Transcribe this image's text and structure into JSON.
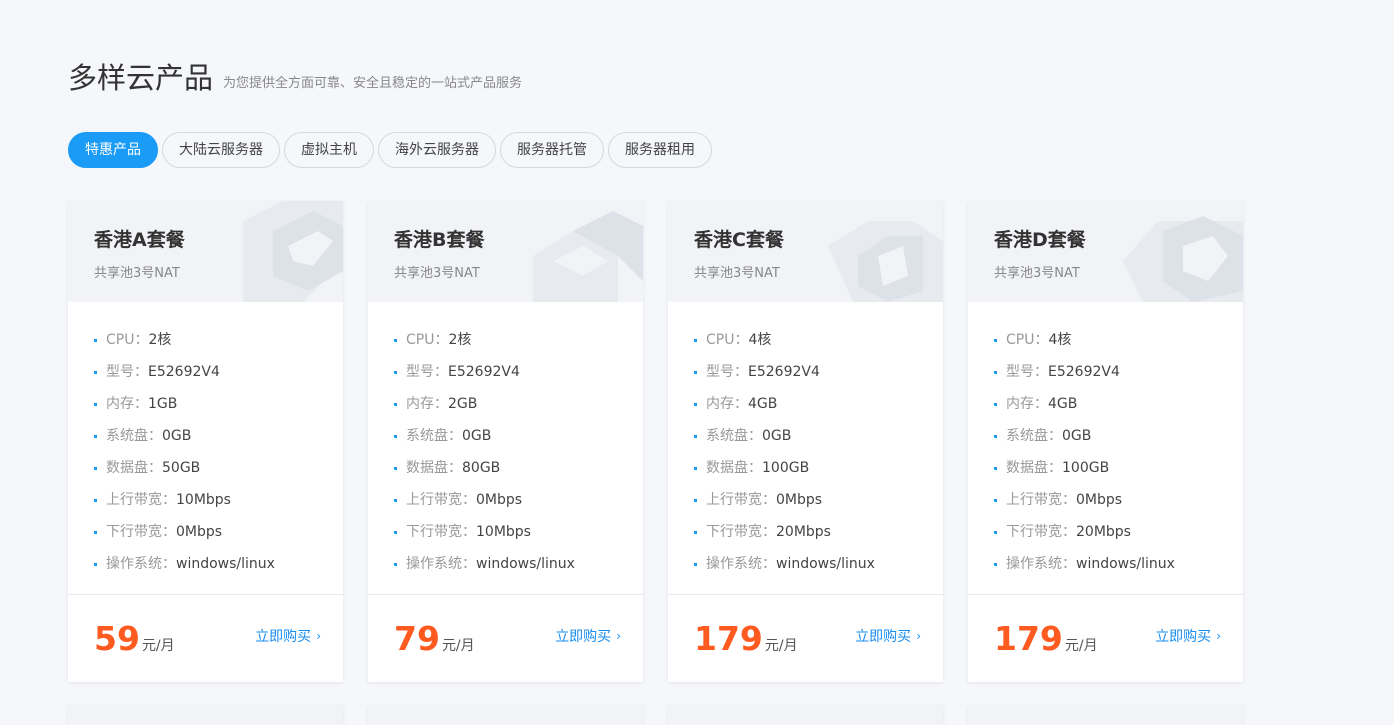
{
  "section": {
    "title": "多样云产品",
    "subtitle": "为您提供全方面可靠、安全且稳定的一站式产品服务"
  },
  "tabs": [
    {
      "label": "特惠产品",
      "active": true
    },
    {
      "label": "大陆云服务器",
      "active": false
    },
    {
      "label": "虚拟主机",
      "active": false
    },
    {
      "label": "海外云服务器",
      "active": false
    },
    {
      "label": "服务器托管",
      "active": false
    },
    {
      "label": "服务器租用",
      "active": false
    }
  ],
  "spec_labels": {
    "cpu": "CPU：",
    "model": "型号：",
    "memory": "内存：",
    "system_disk": "系统盘：",
    "data_disk": "数据盘：",
    "upload": "上行带宽：",
    "download": "下行带宽：",
    "os": "操作系统："
  },
  "cards": [
    {
      "name": "香港A套餐",
      "pool": "共享池3号NAT",
      "specs": {
        "cpu": "2核",
        "model": "E52692V4",
        "memory": "1GB",
        "system_disk": "0GB",
        "data_disk": "50GB",
        "upload": "10Mbps",
        "download": "0Mbps",
        "os": "windows/linux"
      },
      "price": "59",
      "unit": "元/月",
      "buy_label": "立即购买"
    },
    {
      "name": "香港B套餐",
      "pool": "共享池3号NAT",
      "specs": {
        "cpu": "2核",
        "model": "E52692V4",
        "memory": "2GB",
        "system_disk": "0GB",
        "data_disk": "80GB",
        "upload": "0Mbps",
        "download": "10Mbps",
        "os": "windows/linux"
      },
      "price": "79",
      "unit": "元/月",
      "buy_label": "立即购买"
    },
    {
      "name": "香港C套餐",
      "pool": "共享池3号NAT",
      "specs": {
        "cpu": "4核",
        "model": "E52692V4",
        "memory": "4GB",
        "system_disk": "0GB",
        "data_disk": "100GB",
        "upload": "0Mbps",
        "download": "20Mbps",
        "os": "windows/linux"
      },
      "price": "179",
      "unit": "元/月",
      "buy_label": "立即购买"
    },
    {
      "name": "香港D套餐",
      "pool": "共享池3号NAT",
      "specs": {
        "cpu": "4核",
        "model": "E52692V4",
        "memory": "4GB",
        "system_disk": "0GB",
        "data_disk": "100GB",
        "upload": "0Mbps",
        "download": "20Mbps",
        "os": "windows/linux"
      },
      "price": "179",
      "unit": "元/月",
      "buy_label": "立即购买"
    }
  ],
  "colors": {
    "accent": "#1a9bf5",
    "price": "#ff5a1f",
    "link": "#1a8df0"
  }
}
